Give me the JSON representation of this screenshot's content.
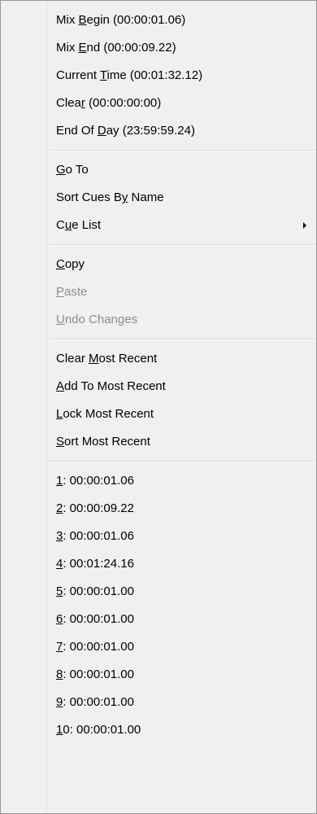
{
  "menu": {
    "sections": [
      {
        "items": [
          {
            "name": "mix-begin-item",
            "parts": [
              "Mix ",
              "B",
              "egin (00:00:01.06)"
            ],
            "disabled": false
          },
          {
            "name": "mix-end-item",
            "parts": [
              "Mix ",
              "E",
              "nd (00:00:09.22)"
            ],
            "disabled": false
          },
          {
            "name": "current-time-item",
            "parts": [
              "Current ",
              "T",
              "ime (00:01:32.12)"
            ],
            "disabled": false
          },
          {
            "name": "clear-item",
            "parts": [
              "Clea",
              "r",
              " (00:00:00:00)"
            ],
            "disabled": false
          },
          {
            "name": "end-of-day-item",
            "parts": [
              "End Of ",
              "D",
              "ay (23:59:59.24)"
            ],
            "disabled": false
          }
        ]
      },
      {
        "items": [
          {
            "name": "go-to-item",
            "parts": [
              "",
              "G",
              "o To"
            ],
            "disabled": false
          },
          {
            "name": "sort-cues-by-name-item",
            "parts": [
              "Sort Cues B",
              "y",
              " Name"
            ],
            "disabled": false
          },
          {
            "name": "cue-list-item",
            "parts": [
              "C",
              "u",
              "e List"
            ],
            "disabled": false,
            "submenu": true
          }
        ]
      },
      {
        "items": [
          {
            "name": "copy-item",
            "parts": [
              "",
              "C",
              "opy"
            ],
            "disabled": false
          },
          {
            "name": "paste-item",
            "parts": [
              "",
              "P",
              "aste"
            ],
            "disabled": true
          },
          {
            "name": "undo-changes-item",
            "parts": [
              "",
              "U",
              "ndo Changes"
            ],
            "disabled": true
          }
        ]
      },
      {
        "items": [
          {
            "name": "clear-most-recent-item",
            "parts": [
              "Clear ",
              "M",
              "ost Recent"
            ],
            "disabled": false
          },
          {
            "name": "add-to-most-recent-item",
            "parts": [
              "",
              "A",
              "dd To Most Recent"
            ],
            "disabled": false
          },
          {
            "name": "lock-most-recent-item",
            "parts": [
              "",
              "L",
              "ock Most Recent"
            ],
            "disabled": false
          },
          {
            "name": "sort-most-recent-item",
            "parts": [
              "",
              "S",
              "ort Most Recent"
            ],
            "disabled": false
          }
        ]
      },
      {
        "items": [
          {
            "name": "recent-item-1",
            "parts": [
              "",
              "1",
              ": 00:00:01.06"
            ],
            "disabled": false
          },
          {
            "name": "recent-item-2",
            "parts": [
              "",
              "2",
              ": 00:00:09.22"
            ],
            "disabled": false
          },
          {
            "name": "recent-item-3",
            "parts": [
              "",
              "3",
              ": 00:00:01.06"
            ],
            "disabled": false
          },
          {
            "name": "recent-item-4",
            "parts": [
              "",
              "4",
              ": 00:01:24.16"
            ],
            "disabled": false
          },
          {
            "name": "recent-item-5",
            "parts": [
              "",
              "5",
              ": 00:00:01.00"
            ],
            "disabled": false
          },
          {
            "name": "recent-item-6",
            "parts": [
              "",
              "6",
              ": 00:00:01.00"
            ],
            "disabled": false
          },
          {
            "name": "recent-item-7",
            "parts": [
              "",
              "7",
              ": 00:00:01.00"
            ],
            "disabled": false
          },
          {
            "name": "recent-item-8",
            "parts": [
              "",
              "8",
              ": 00:00:01.00"
            ],
            "disabled": false
          },
          {
            "name": "recent-item-9",
            "parts": [
              "",
              "9",
              ": 00:00:01.00"
            ],
            "disabled": false
          },
          {
            "name": "recent-item-10",
            "parts": [
              "",
              "1",
              "0: 00:00:01.00"
            ],
            "disabled": false
          }
        ]
      }
    ],
    "submenu_icon": "chevron-right-icon"
  }
}
